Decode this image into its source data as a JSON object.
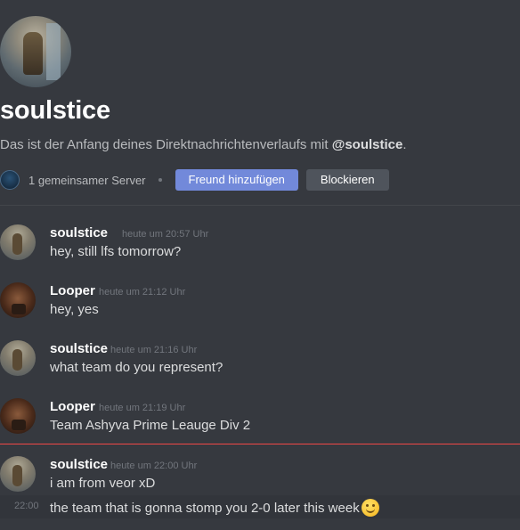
{
  "profile": {
    "name": "soulstice",
    "intro_prefix": "Das ist der Anfang deines Direktnachrichtenverlaufs mit ",
    "intro_mention": "@soulstice",
    "intro_suffix": ".",
    "mutual_servers": "1 gemeinsamer Server",
    "add_friend_label": "Freund hinzufügen",
    "block_label": "Blockieren"
  },
  "messages": [
    {
      "author": "soulstice",
      "time": "heute um 20:57 Uhr",
      "text": "hey, still lfs tomorrow?"
    },
    {
      "author": "Looper",
      "time": "heute um 21:12 Uhr",
      "text": "hey, yes"
    },
    {
      "author": "soulstice",
      "time": "heute um 21:16 Uhr",
      "text": "what team do you represent?"
    },
    {
      "author": "Looper",
      "time": "heute um 21:19 Uhr",
      "text": "Team Ashyva Prime Leauge Div 2"
    },
    {
      "author": "soulstice",
      "time": "heute um 22:00 Uhr",
      "text": "i am from veor xD"
    }
  ],
  "followup": {
    "time": "22:00",
    "text": "the team that is gonna stomp you 2-0 later this week",
    "emoji": "slightly-smiling-face-emoji"
  },
  "colors": {
    "accent": "#7289da",
    "new_messages_line": "#f04747",
    "background": "#36393f"
  }
}
